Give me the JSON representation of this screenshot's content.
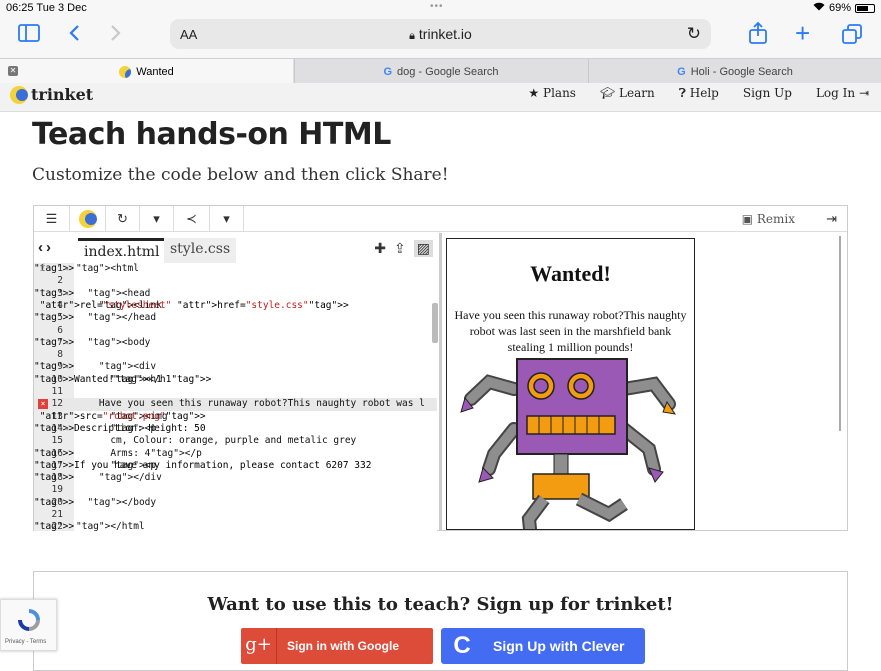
{
  "status_bar": {
    "time": "06:25",
    "date": "Tue 3 Dec",
    "battery": "69%",
    "battery_level": 0.69
  },
  "browser": {
    "text_size_label": "AA",
    "url": "trinket.io",
    "tabs": [
      {
        "label": "Wanted",
        "active": true
      },
      {
        "label": "dog - Google Search",
        "active": false
      },
      {
        "label": "Holi - Google Search",
        "active": false
      }
    ]
  },
  "site": {
    "logo_text": "trinket",
    "nav": [
      "Plans",
      "Learn",
      "Help",
      "Sign Up",
      "Log In"
    ]
  },
  "page": {
    "title": "Teach hands-on HTML",
    "subtitle": "Customize the code below and then click Share!"
  },
  "editor": {
    "remix_label": "Remix",
    "file_tabs": [
      "index.html",
      "style.css"
    ],
    "code_lines": [
      {
        "n": "1",
        "fold": true,
        "text": "<html>"
      },
      {
        "n": "2",
        "fold": false,
        "text": ""
      },
      {
        "n": "3",
        "fold": true,
        "text": "  <head>"
      },
      {
        "n": "4",
        "fold": false,
        "text": "    <link rel=\"stylesheet\" href=\"style.css\">"
      },
      {
        "n": "5",
        "fold": false,
        "text": "  </head>"
      },
      {
        "n": "6",
        "fold": false,
        "text": ""
      },
      {
        "n": "7",
        "fold": true,
        "text": "  <body>"
      },
      {
        "n": "8",
        "fold": false,
        "text": ""
      },
      {
        "n": "9",
        "fold": true,
        "text": "    <div>"
      },
      {
        "n": "10",
        "fold": false,
        "text": "      <h1>Wanted!</h1>"
      },
      {
        "n": "11",
        "fold": false,
        "text": ""
      },
      {
        "n": "12",
        "fold": false,
        "text": "    Have you seen this runaway robot?This naughty robot was l"
      },
      {
        "n": "13",
        "fold": false,
        "text": "      <img src=\"robot.png\">"
      },
      {
        "n": "14",
        "fold": true,
        "text": "      <p>Description: Height: 50"
      },
      {
        "n": "15",
        "fold": false,
        "text": "      cm, Colour: orange, purple and metalic grey"
      },
      {
        "n": "16",
        "fold": false,
        "text": "      Arms: 4</p>"
      },
      {
        "n": "17",
        "fold": false,
        "text": "      <p>If you have any information, please contact 6207 332"
      },
      {
        "n": "18",
        "fold": false,
        "text": "    </div>"
      },
      {
        "n": "19",
        "fold": false,
        "text": ""
      },
      {
        "n": "20",
        "fold": false,
        "text": "  </body>"
      },
      {
        "n": "21",
        "fold": false,
        "text": ""
      },
      {
        "n": "22",
        "fold": false,
        "text": "</html>"
      }
    ],
    "error_line": "12",
    "error_marker": "×",
    "info_marker": "i"
  },
  "preview": {
    "heading": "Wanted!",
    "text": "Have you seen this runaway robot?This naughty robot was last seen in the marshfield bank stealing 1 million pounds!"
  },
  "signup": {
    "title": "Want to use this to teach? Sign up for trinket!",
    "google_icon": "g+",
    "google_label": "Sign in with Google",
    "clever_icon": "C",
    "clever_label": "Sign Up with Clever"
  },
  "recaptcha": {
    "terms": "Privacy - Terms"
  },
  "colors": {
    "accent": "#2a7bf6",
    "google_red": "#dd4b39",
    "clever_blue": "#436cf2",
    "robot_purple": "#9b59b6",
    "robot_orange": "#f39c12",
    "robot_grey": "#8e8e8e"
  }
}
